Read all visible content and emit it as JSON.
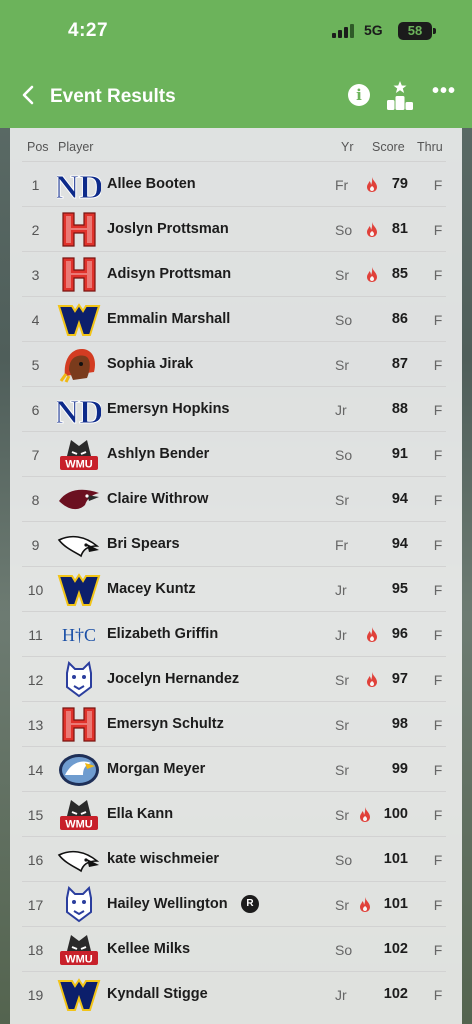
{
  "status": {
    "time": "4:27",
    "network": "5G",
    "battery": "58"
  },
  "nav": {
    "title": "Event Results",
    "info_label": "i",
    "more_label": "•••"
  },
  "columns": {
    "pos": "Pos",
    "player": "Player",
    "yr": "Yr",
    "score": "Score",
    "thru": "Thru"
  },
  "colors": {
    "header": "#6cb35b",
    "flame": "#e0413a"
  },
  "rows": [
    {
      "pos": "1",
      "name": "Allee Booten",
      "yr": "Fr",
      "score": "79",
      "thru": "F",
      "hot": true,
      "logo": "nd-logo-icon"
    },
    {
      "pos": "2",
      "name": "Joslyn Prottsman",
      "yr": "So",
      "score": "81",
      "thru": "F",
      "hot": true,
      "logo": "h-logo-icon"
    },
    {
      "pos": "3",
      "name": "Adisyn Prottsman",
      "yr": "Sr",
      "score": "85",
      "thru": "F",
      "hot": true,
      "logo": "h-logo-icon"
    },
    {
      "pos": "4",
      "name": "Emmalin Marshall",
      "yr": "So",
      "score": "86",
      "thru": "F",
      "hot": false,
      "logo": "w-logo-icon"
    },
    {
      "pos": "5",
      "name": "Sophia Jirak",
      "yr": "Sr",
      "score": "87",
      "thru": "F",
      "hot": false,
      "logo": "chief-logo-icon"
    },
    {
      "pos": "6",
      "name": "Emersyn Hopkins",
      "yr": "Jr",
      "score": "88",
      "thru": "F",
      "hot": false,
      "logo": "nd-logo-icon"
    },
    {
      "pos": "7",
      "name": "Ashlyn Bender",
      "yr": "So",
      "score": "91",
      "thru": "F",
      "hot": false,
      "logo": "wmu-logo-icon"
    },
    {
      "pos": "8",
      "name": "Claire Withrow",
      "yr": "Sr",
      "score": "94",
      "thru": "F",
      "hot": false,
      "logo": "raven-logo-icon"
    },
    {
      "pos": "9",
      "name": "Bri Spears",
      "yr": "Fr",
      "score": "94",
      "thru": "F",
      "hot": false,
      "logo": "hawk-logo-icon"
    },
    {
      "pos": "10",
      "name": "Macey Kuntz",
      "yr": "Jr",
      "score": "95",
      "thru": "F",
      "hot": false,
      "logo": "w-logo-icon"
    },
    {
      "pos": "11",
      "name": "Elizabeth Griffin",
      "yr": "Jr",
      "score": "96",
      "thru": "F",
      "hot": true,
      "logo": "htc-logo-icon"
    },
    {
      "pos": "12",
      "name": "Jocelyn Hernandez",
      "yr": "Sr",
      "score": "97",
      "thru": "F",
      "hot": true,
      "logo": "wildcat-logo-icon"
    },
    {
      "pos": "13",
      "name": "Emersyn Schultz",
      "yr": "Sr",
      "score": "98",
      "thru": "F",
      "hot": false,
      "logo": "h-logo-icon"
    },
    {
      "pos": "14",
      "name": "Morgan Meyer",
      "yr": "Sr",
      "score": "99",
      "thru": "F",
      "hot": false,
      "logo": "eagle-logo-icon"
    },
    {
      "pos": "15",
      "name": "Ella Kann",
      "yr": "Sr",
      "score": "100",
      "thru": "F",
      "hot": true,
      "logo": "wmu-logo-icon"
    },
    {
      "pos": "16",
      "name": "kate wischmeier",
      "yr": "So",
      "score": "101",
      "thru": "F",
      "hot": false,
      "logo": "hawk-logo-icon"
    },
    {
      "pos": "17",
      "name": "Hailey Wellington",
      "yr": "Sr",
      "score": "101",
      "thru": "F",
      "hot": true,
      "logo": "wildcat-logo-icon",
      "badge": "R"
    },
    {
      "pos": "18",
      "name": "Kellee Milks",
      "yr": "So",
      "score": "102",
      "thru": "F",
      "hot": false,
      "logo": "wmu-logo-icon"
    },
    {
      "pos": "19",
      "name": "Kyndall Stigge",
      "yr": "Jr",
      "score": "102",
      "thru": "F",
      "hot": false,
      "logo": "w-logo-icon"
    }
  ]
}
